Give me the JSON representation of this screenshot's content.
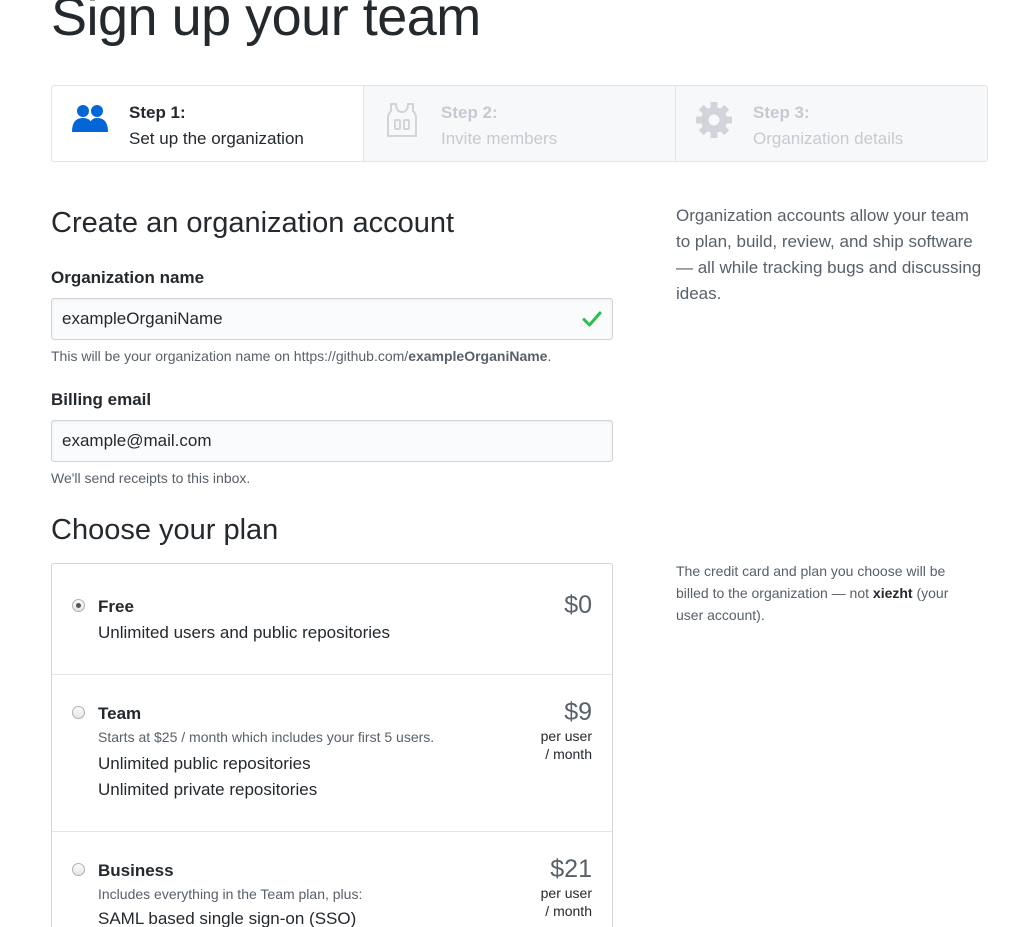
{
  "page_title": "Sign up your team",
  "steps": [
    {
      "number": "Step 1:",
      "label": "Set up the organization",
      "icon": "people-icon",
      "active": true
    },
    {
      "number": "Step 2:",
      "label": "Invite members",
      "icon": "jersey-icon",
      "active": false
    },
    {
      "number": "Step 3:",
      "label": "Organization details",
      "icon": "gear-icon",
      "active": false
    }
  ],
  "account_section": {
    "heading": "Create an organization account",
    "org_name": {
      "label": "Organization name",
      "value": "exampleOrganiName",
      "valid": true,
      "note_prefix": "This will be your organization name on https://github.com/",
      "note_name": "exampleOrganiName",
      "note_suffix": "."
    },
    "billing_email": {
      "label": "Billing email",
      "value": "example@mail.com",
      "note": "We'll send receipts to this inbox."
    }
  },
  "sidebar": {
    "about": "Organization accounts allow your team to plan, build, review, and ship software — all while tracking bugs and discussing ideas.",
    "billing_prefix": "The credit card and plan you choose will be billed to the organization — not ",
    "billing_user": "xiezht",
    "billing_suffix": " (your user account)."
  },
  "plan_section": {
    "heading": "Choose your plan",
    "plans": [
      {
        "name": "Free",
        "selected": true,
        "price": "$0",
        "lines": [
          "Unlimited users and public repositories"
        ]
      },
      {
        "name": "Team",
        "selected": false,
        "subtitle": "Starts at $25 / month which includes your first 5 users.",
        "price": "$9",
        "unit_line1": "per user",
        "unit_line2": "/ month",
        "lines": [
          "Unlimited public repositories",
          "Unlimited private repositories"
        ]
      },
      {
        "name": "Business",
        "selected": false,
        "subtitle": "Includes everything in the Team plan, plus:",
        "price": "$21",
        "unit_line1": "per user",
        "unit_line2": "/ month",
        "lines": [
          "SAML based single sign-on (SSO)"
        ]
      }
    ]
  },
  "colors": {
    "active_icon": "#0366d6",
    "inactive_icon": "#d1d5da",
    "valid_check": "#2cbe4e"
  }
}
